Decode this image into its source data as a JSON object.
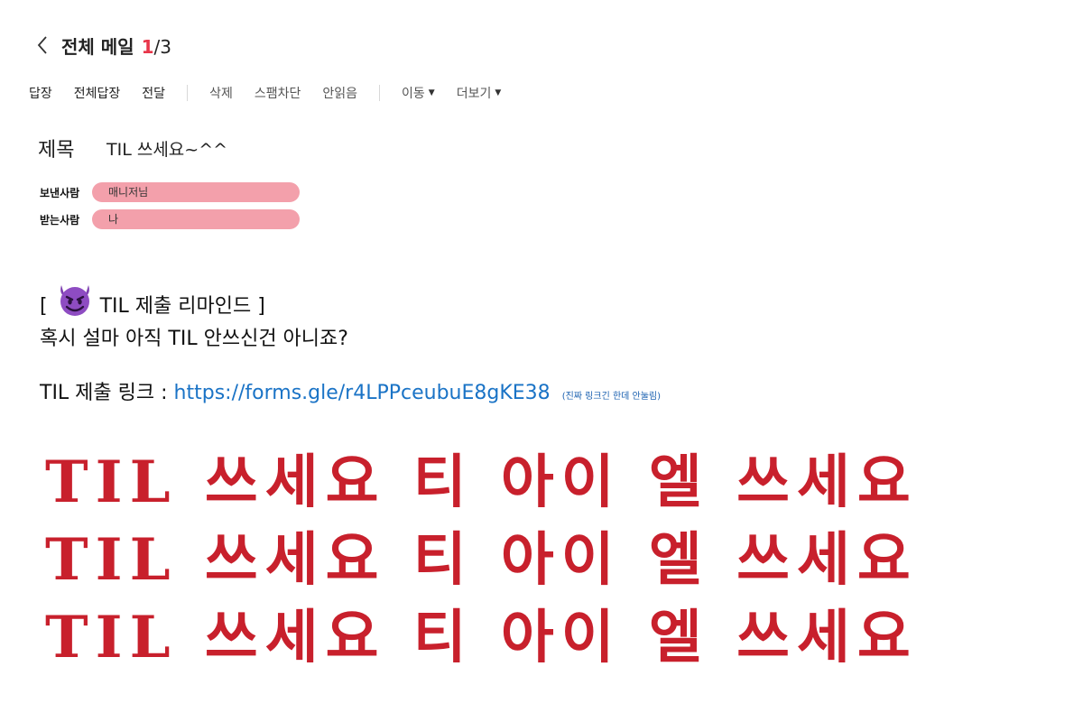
{
  "header": {
    "title": "전체 메일",
    "current": "1",
    "separator": "/",
    "total": "3",
    "back_icon": "chevron-left-icon"
  },
  "toolbar": {
    "reply": "답장",
    "reply_all": "전체답장",
    "forward": "전달",
    "delete": "삭제",
    "block_spam": "스팸차단",
    "mark_unread": "안읽음",
    "move": "이동",
    "more": "더보기"
  },
  "mail": {
    "subject_label": "제목",
    "subject": "TIL 쓰세요~^^",
    "from_label": "보낸사람",
    "from": "매니저님",
    "to_label": "받는사람",
    "to": "나",
    "pill_color": "#f3a0ab",
    "body": {
      "line1_open": "[",
      "line1_emoji": "smiling-devil-icon",
      "line1_text": "TIL 제출 리마인드 ]",
      "line2": "혹시 설마 아직 TIL 안쓰신건 아니죠?",
      "link_label": "TIL 제출 링크 :",
      "link_url": "https://forms.gle/r4LPPceubuE8gKE38",
      "link_note": "(진짜 링크긴 한데 안눌림)",
      "link_color": "#1a73c6"
    },
    "big_lines": [
      "TIL 쓰세요 티 아이 엘 쓰세요",
      "TIL 쓰세요 티 아이 엘 쓰세요",
      "TIL 쓰세요 티 아이 엘 쓰세요"
    ],
    "big_color": "#c8202c"
  },
  "colors": {
    "accent": "#e8364a"
  }
}
